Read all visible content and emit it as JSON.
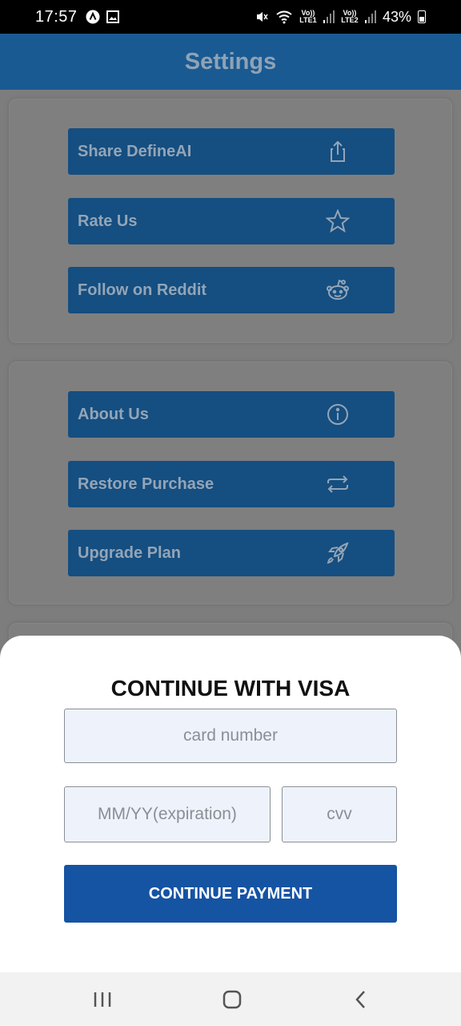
{
  "status_bar": {
    "time": "17:57",
    "sim1": "Vo)) LTE1",
    "sim2": "Vo)) LTE2",
    "battery": "43%"
  },
  "header": {
    "title": "Settings"
  },
  "groups": [
    {
      "items": [
        {
          "label": "Share DefineAI",
          "icon": "share-icon"
        },
        {
          "label": "Rate Us",
          "icon": "star-icon"
        },
        {
          "label": "Follow on Reddit",
          "icon": "reddit-icon"
        }
      ]
    },
    {
      "items": [
        {
          "label": "About Us",
          "icon": "info-icon"
        },
        {
          "label": "Restore Purchase",
          "icon": "repeat-icon"
        },
        {
          "label": "Upgrade Plan",
          "icon": "rocket-icon"
        }
      ]
    }
  ],
  "sheet": {
    "title": "CONTINUE WITH VISA",
    "card_number_placeholder": "card number",
    "expiration_placeholder": "MM/YY(expiration)",
    "cvv_placeholder": "cvv",
    "button_label": "CONTINUE PAYMENT"
  },
  "colors": {
    "header": "#1a5a92",
    "menu_button": "#154e80",
    "pay_button": "#1553a3",
    "field_bg": "#eef3fb"
  }
}
